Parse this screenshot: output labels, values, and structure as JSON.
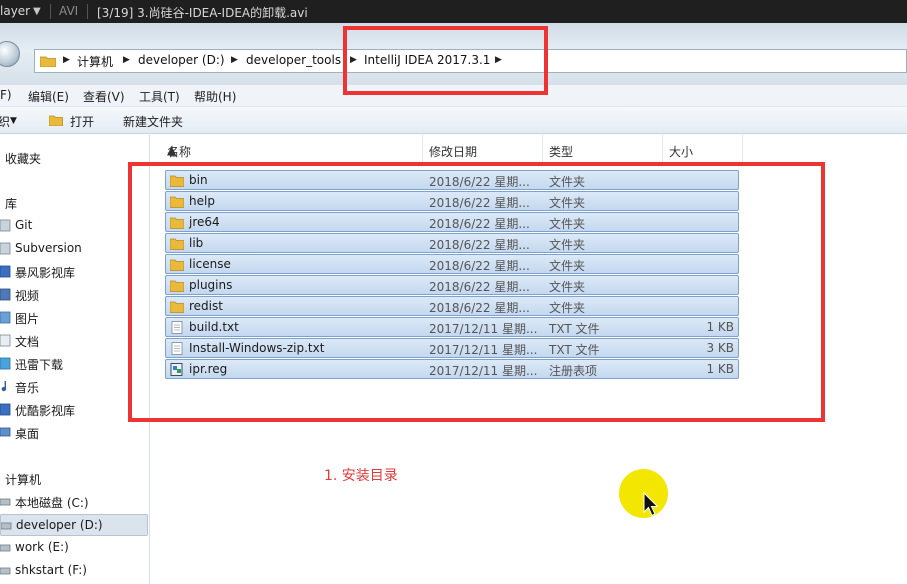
{
  "player": {
    "name": "layer",
    "format": "AVI",
    "title": "[3/19] 3.尚硅谷-IDEA-IDEA的卸载.avi"
  },
  "address": {
    "crumbs": [
      "计算机",
      "developer (D:)",
      "developer_tools",
      "IntelliJ IDEA 2017.3.1"
    ]
  },
  "menu": {
    "items": [
      "F)",
      "编辑(E)",
      "查看(V)",
      "工具(T)",
      "帮助(H)"
    ]
  },
  "toolbar": {
    "organize_label": "织",
    "open_label": "打开",
    "new_folder_label": "新建文件夹"
  },
  "sidebar": {
    "items": [
      {
        "label": "收藏夹",
        "header": true
      },
      {
        "label": "库",
        "header": true
      },
      {
        "label": "Git"
      },
      {
        "label": "Subversion"
      },
      {
        "label": "暴风影视库"
      },
      {
        "label": "视频"
      },
      {
        "label": "图片"
      },
      {
        "label": "文档"
      },
      {
        "label": "迅雷下载"
      },
      {
        "label": "音乐"
      },
      {
        "label": "优酷影视库"
      },
      {
        "label": "桌面"
      },
      {
        "label": "计算机",
        "header": true
      },
      {
        "label": "本地磁盘 (C:)"
      },
      {
        "label": "developer (D:)",
        "selected": true
      },
      {
        "label": "work (E:)"
      },
      {
        "label": "shkstart (F:)"
      }
    ]
  },
  "columns": {
    "name": "名称",
    "date": "修改日期",
    "type": "类型",
    "size": "大小"
  },
  "files": [
    {
      "name": "bin",
      "date": "2018/6/22 星期...",
      "type": "文件夹",
      "size": "",
      "icon": "folder"
    },
    {
      "name": "help",
      "date": "2018/6/22 星期...",
      "type": "文件夹",
      "size": "",
      "icon": "folder"
    },
    {
      "name": "jre64",
      "date": "2018/6/22 星期...",
      "type": "文件夹",
      "size": "",
      "icon": "folder"
    },
    {
      "name": "lib",
      "date": "2018/6/22 星期...",
      "type": "文件夹",
      "size": "",
      "icon": "folder"
    },
    {
      "name": "license",
      "date": "2018/6/22 星期...",
      "type": "文件夹",
      "size": "",
      "icon": "folder"
    },
    {
      "name": "plugins",
      "date": "2018/6/22 星期...",
      "type": "文件夹",
      "size": "",
      "icon": "folder"
    },
    {
      "name": "redist",
      "date": "2018/6/22 星期...",
      "type": "文件夹",
      "size": "",
      "icon": "folder"
    },
    {
      "name": "build.txt",
      "date": "2017/12/11 星期...",
      "type": "TXT 文件",
      "size": "1 KB",
      "icon": "text-file"
    },
    {
      "name": "Install-Windows-zip.txt",
      "date": "2017/12/11 星期...",
      "type": "TXT 文件",
      "size": "3 KB",
      "icon": "text-file"
    },
    {
      "name": "ipr.reg",
      "date": "2017/12/11 星期...",
      "type": "注册表项",
      "size": "1 KB",
      "icon": "registry-file"
    }
  ],
  "annotation": {
    "caption": "1. 安装目录",
    "color": "#ee3333"
  },
  "colors": {
    "selection_fill": "#c4d8ef",
    "selection_border": "#7da2ce",
    "folder": "#e8b93a",
    "cursor_highlight": "#f3e600"
  }
}
